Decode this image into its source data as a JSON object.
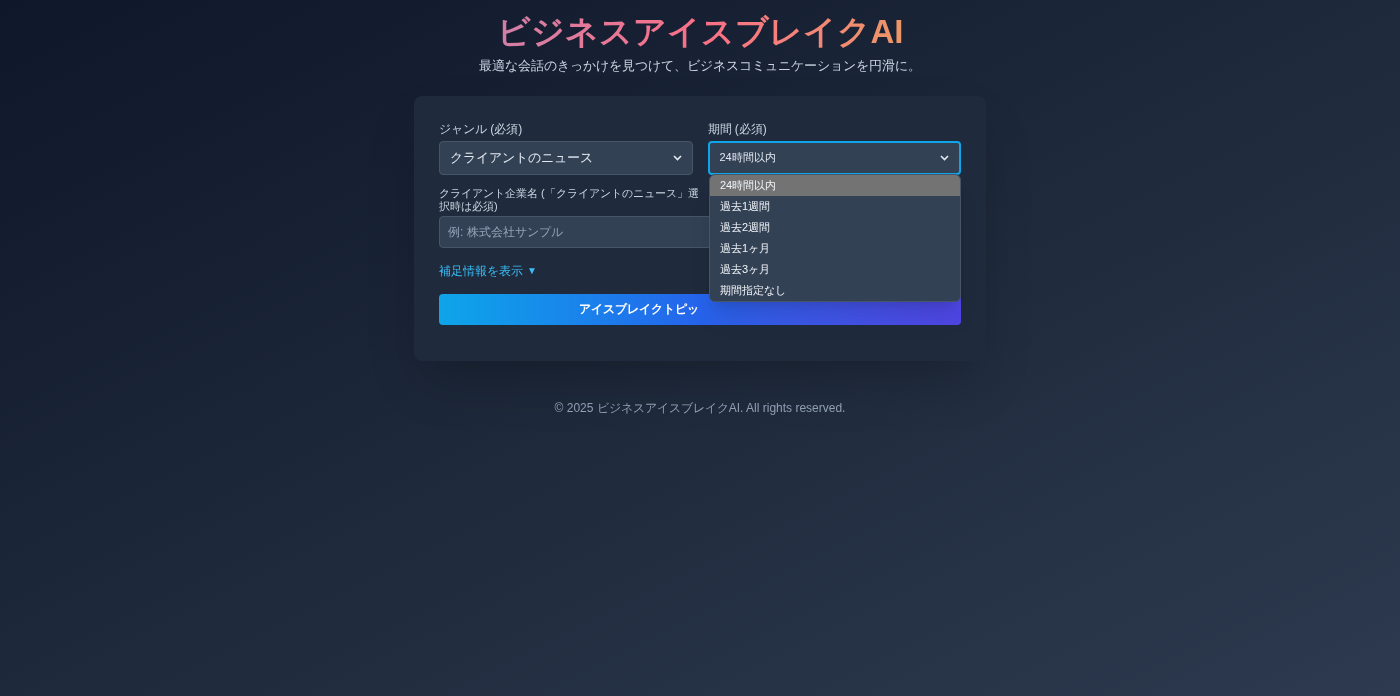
{
  "header": {
    "title": "ビジネスアイスブレイクAI",
    "subtitle": "最適な会話のきっかけを見つけて、ビジネスコミュニケーションを円滑に。"
  },
  "form": {
    "genre": {
      "label": "ジャンル (必須)",
      "value": "クライアントのニュース"
    },
    "period": {
      "label": "期間 (必須)",
      "value": "24時間以内",
      "focused": true,
      "expanded": true,
      "options": [
        {
          "label": "24時間以内",
          "selected": true
        },
        {
          "label": "過去1週間",
          "selected": false
        },
        {
          "label": "過去2週間",
          "selected": false
        },
        {
          "label": "過去1ヶ月",
          "selected": false
        },
        {
          "label": "過去3ヶ月",
          "selected": false
        },
        {
          "label": "期間指定なし",
          "selected": false
        }
      ]
    },
    "client": {
      "label": "クライアント企業名 (「クライアントのニュース」選択時は必須)",
      "placeholder": "例: 株式会社サンプル"
    },
    "toggle": {
      "label": "補足情報を表示",
      "icon": "▼"
    },
    "submit": {
      "label": "アイスブレイクトピッ"
    }
  },
  "footer": "© 2025 ビジネスアイスブレイクAI. All rights reserved."
}
